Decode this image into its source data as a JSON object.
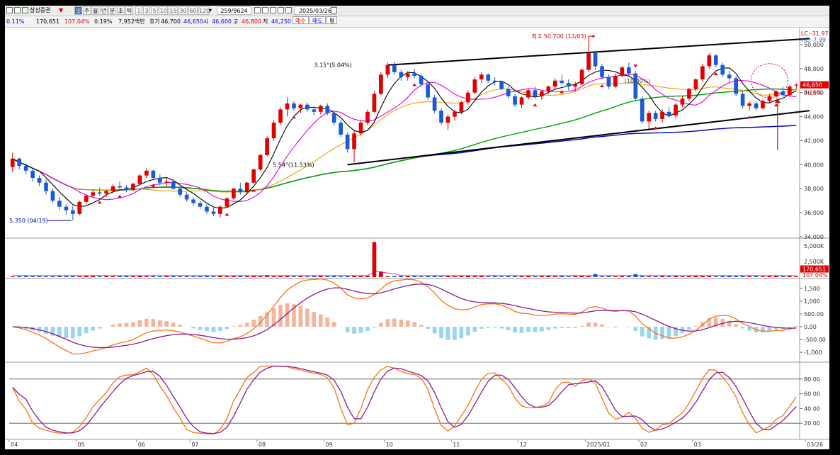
{
  "toolbar": {
    "broker": "삼성증권",
    "periods": [
      "일",
      "주",
      "월",
      "년",
      "분",
      "초",
      "틱"
    ],
    "intervals": [
      "1",
      "3",
      "5",
      "10",
      "15",
      "30",
      "60",
      "120"
    ],
    "count": "259/9624",
    "date": "2025/03/26"
  },
  "quote": {
    "change_pct_partial": "0.11%",
    "volume": "170,651",
    "volume_ratio": "107.04%",
    "turnover_pct": "0.19%",
    "amount": "7,952백만",
    "ask_label": "호가",
    "ask": "46,700",
    "bid": "46,650",
    "open_label": "시",
    "open": "46,600",
    "high_label": "고",
    "high": "46,800",
    "low_label": "저",
    "low": "46,250",
    "buy_btn": "매수",
    "sell_btn": "매도",
    "eval_btn": "평"
  },
  "colors": {
    "up": "#e00000",
    "down": "#1a5ad8",
    "ma5": "#000000",
    "ma10": "#e000e0",
    "ma20": "#f0a000",
    "ma60": "#00a000",
    "ma120": "#0000c0",
    "macd": "#ff7010",
    "signal": "#8a1c8a",
    "hist_pos": "#f4b49a",
    "hist_neg": "#9ad4ee",
    "stoch_k": "#ff7010",
    "stoch_d": "#8a1c8a"
  },
  "chart_data": [
    {
      "type": "candlestick",
      "panel": "price",
      "x_labels": [
        "04",
        "05",
        "06",
        "07",
        "08",
        "09",
        "10",
        "11",
        "12",
        "2025/01",
        "02",
        "03",
        "03/26"
      ],
      "ylim": [
        34000,
        51000
      ],
      "y_ticks": [
        "34,000",
        "36,000",
        "38,000",
        "40,000",
        "42,000",
        "44,000",
        "46,000",
        "48,000",
        "50,000"
      ],
      "candles": [
        [
          39800,
          41000,
          39400,
          40500
        ],
        [
          40500,
          40600,
          39600,
          39900
        ],
        [
          39900,
          40100,
          39200,
          39500
        ],
        [
          39500,
          39700,
          38600,
          38900
        ],
        [
          38900,
          39100,
          38200,
          38500
        ],
        [
          38500,
          38800,
          37500,
          37800
        ],
        [
          37800,
          38000,
          36800,
          37000
        ],
        [
          37000,
          37300,
          36200,
          36500
        ],
        [
          36500,
          36700,
          35800,
          36200
        ],
        [
          36200,
          36600,
          35350,
          35900
        ],
        [
          35900,
          37000,
          35800,
          36900
        ],
        [
          36900,
          37600,
          36700,
          37400
        ],
        [
          37400,
          37900,
          37200,
          37700
        ],
        [
          37700,
          38100,
          37400,
          37600
        ],
        [
          37600,
          37900,
          37300,
          37800
        ],
        [
          37800,
          38400,
          37600,
          38200
        ],
        [
          38200,
          38600,
          37900,
          38100
        ],
        [
          38100,
          38300,
          37700,
          37900
        ],
        [
          37900,
          38500,
          37800,
          38400
        ],
        [
          38400,
          39200,
          38300,
          39100
        ],
        [
          39100,
          39700,
          38900,
          39500
        ],
        [
          39500,
          39600,
          38800,
          38900
        ],
        [
          38900,
          39200,
          38300,
          38500
        ],
        [
          38500,
          38900,
          38200,
          38600
        ],
        [
          38600,
          38700,
          37900,
          38000
        ],
        [
          38000,
          38200,
          37300,
          37500
        ],
        [
          37500,
          37700,
          36900,
          37100
        ],
        [
          37100,
          37300,
          36600,
          36800
        ],
        [
          36800,
          37000,
          36300,
          36500
        ],
        [
          36500,
          36700,
          35900,
          36100
        ],
        [
          36100,
          36400,
          35700,
          35900
        ],
        [
          35900,
          36600,
          35600,
          36500
        ],
        [
          36500,
          37300,
          36400,
          37200
        ],
        [
          37200,
          38100,
          37100,
          38000
        ],
        [
          38000,
          38500,
          37500,
          37700
        ],
        [
          37700,
          38600,
          37600,
          38500
        ],
        [
          38500,
          39700,
          38400,
          39600
        ],
        [
          39600,
          40900,
          39500,
          40800
        ],
        [
          40800,
          42400,
          40700,
          42200
        ],
        [
          42200,
          43700,
          42000,
          43500
        ],
        [
          43500,
          44800,
          43300,
          44600
        ],
        [
          44600,
          45600,
          44000,
          45100
        ],
        [
          45100,
          45300,
          44500,
          44700
        ],
        [
          44700,
          45100,
          44300,
          45000
        ],
        [
          45000,
          45200,
          44400,
          44600
        ],
        [
          44600,
          44900,
          44100,
          44400
        ],
        [
          44400,
          45000,
          44200,
          44900
        ],
        [
          44900,
          45100,
          44100,
          44300
        ],
        [
          44300,
          44400,
          43300,
          43500
        ],
        [
          43500,
          43700,
          42300,
          42500
        ],
        [
          42500,
          42700,
          41000,
          41300
        ],
        [
          41300,
          42800,
          40200,
          42600
        ],
        [
          42600,
          43700,
          42400,
          43500
        ],
        [
          43500,
          44600,
          43300,
          44400
        ],
        [
          44400,
          46100,
          44300,
          45900
        ],
        [
          45900,
          47700,
          45800,
          47500
        ],
        [
          47500,
          48500,
          47200,
          48300
        ],
        [
          48300,
          48600,
          47500,
          47700
        ],
        [
          47700,
          47900,
          47000,
          47300
        ],
        [
          47300,
          47800,
          47000,
          47600
        ],
        [
          47600,
          48000,
          47200,
          47400
        ],
        [
          47400,
          47600,
          46500,
          46700
        ],
        [
          46700,
          46900,
          45400,
          45600
        ],
        [
          45600,
          45800,
          44300,
          44500
        ],
        [
          44500,
          44700,
          43300,
          43500
        ],
        [
          43500,
          44200,
          42900,
          44000
        ],
        [
          44000,
          44600,
          43700,
          44400
        ],
        [
          44400,
          45300,
          44200,
          45200
        ],
        [
          45200,
          46200,
          45000,
          46000
        ],
        [
          46000,
          47300,
          45900,
          47100
        ],
        [
          47100,
          47700,
          46800,
          47500
        ],
        [
          47500,
          47600,
          46800,
          47000
        ],
        [
          47000,
          47300,
          46600,
          46900
        ],
        [
          46900,
          47000,
          46200,
          46300
        ],
        [
          46300,
          46500,
          45500,
          45700
        ],
        [
          45700,
          45900,
          44800,
          45000
        ],
        [
          45000,
          45700,
          44700,
          45600
        ],
        [
          45600,
          46300,
          45400,
          46200
        ],
        [
          46200,
          46500,
          45500,
          45700
        ],
        [
          45700,
          46200,
          45400,
          46100
        ],
        [
          46100,
          46600,
          45900,
          46500
        ],
        [
          46500,
          47200,
          46200,
          47000
        ],
        [
          47000,
          47500,
          46600,
          46800
        ],
        [
          46800,
          47100,
          46200,
          46500
        ],
        [
          46500,
          46900,
          46100,
          46700
        ],
        [
          46700,
          48000,
          46600,
          47900
        ],
        [
          47900,
          50700,
          47700,
          49300
        ],
        [
          49300,
          49500,
          47900,
          48200
        ],
        [
          48200,
          48400,
          47100,
          47300
        ],
        [
          47300,
          47500,
          46300,
          46500
        ],
        [
          46500,
          47600,
          46400,
          47400
        ],
        [
          47400,
          48200,
          47300,
          48100
        ],
        [
          48100,
          48500,
          47400,
          47600
        ],
        [
          47600,
          47800,
          45300,
          45500
        ],
        [
          45500,
          45700,
          43400,
          43600
        ],
        [
          43600,
          44500,
          43000,
          44300
        ],
        [
          44300,
          44500,
          43600,
          43800
        ],
        [
          43800,
          44600,
          43500,
          44400
        ],
        [
          44400,
          44800,
          43900,
          44100
        ],
        [
          44100,
          45100,
          43900,
          45000
        ],
        [
          45000,
          45700,
          44800,
          45500
        ],
        [
          45500,
          46400,
          45300,
          46300
        ],
        [
          46300,
          47200,
          46100,
          47100
        ],
        [
          47100,
          48400,
          46900,
          48200
        ],
        [
          48200,
          49300,
          48000,
          49100
        ],
        [
          49100,
          49200,
          48100,
          48300
        ],
        [
          48300,
          48500,
          47300,
          47500
        ],
        [
          47500,
          47800,
          46900,
          47200
        ],
        [
          47200,
          47400,
          45700,
          45900
        ],
        [
          45900,
          46100,
          44700,
          44900
        ],
        [
          44900,
          45300,
          44500,
          45100
        ],
        [
          45100,
          45300,
          44500,
          44700
        ],
        [
          44700,
          45400,
          44600,
          45300
        ],
        [
          45300,
          45900,
          45100,
          45700
        ],
        [
          45700,
          46200,
          45500,
          46100
        ],
        [
          46100,
          46500,
          45600,
          45800
        ],
        [
          45800,
          46600,
          45700,
          46500
        ],
        [
          46600,
          46800,
          46250,
          46650
        ]
      ],
      "annotations": {
        "high_label": "최고 50,700 (12/03)",
        "low_label": "5,350 (04/19)",
        "label_315": "3.15°(5.04%)",
        "label_554": "5.54°(11.53%)",
        "label_mid": "(10.00%)",
        "pct_label": "0.21%",
        "lc": "LC:-31.97",
        "hc": "HC:-7.99",
        "last_price": "46,650"
      }
    },
    {
      "type": "bar",
      "panel": "volume",
      "ylim": [
        0,
        6000
      ],
      "y_ticks": [
        "2,500K",
        "5,000K"
      ],
      "last_value": "170,651",
      "last_ratio": "107.04%"
    },
    {
      "type": "line",
      "panel": "macd",
      "ylim": [
        -1300,
        1800
      ],
      "y_ticks": [
        "-1,000",
        "-500.00",
        "0.00",
        "500.00",
        "1,000",
        "1,500"
      ],
      "series": [
        {
          "key": "macd"
        },
        {
          "key": "signal"
        },
        {
          "key": "histogram"
        }
      ]
    },
    {
      "type": "line",
      "panel": "stochastic",
      "ylim": [
        0,
        100
      ],
      "y_ticks": [
        "20.00",
        "40.00",
        "60.00",
        "80.00"
      ],
      "levels": [
        20,
        80
      ],
      "series": [
        {
          "key": "slow_k"
        },
        {
          "key": "slow_d"
        }
      ]
    }
  ]
}
